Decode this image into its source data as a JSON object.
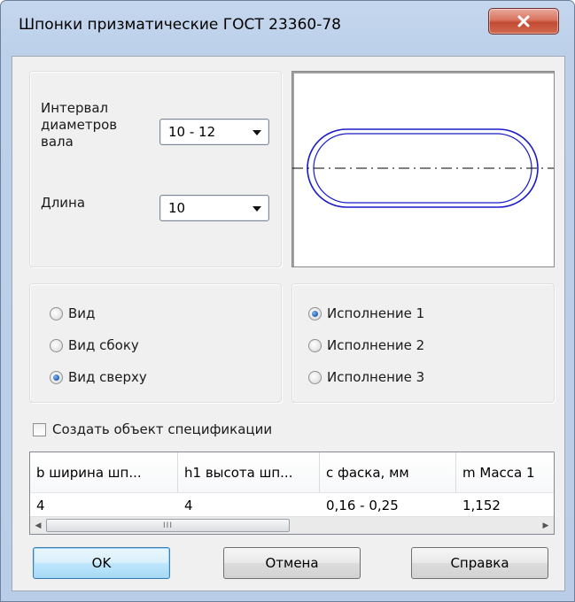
{
  "window": {
    "title": "Шпонки призматические  ГОСТ 23360-78",
    "close_icon": "close-icon",
    "close_color": "#c9503a"
  },
  "params": {
    "interval_label": "Интервал\nдиаметров\nвала",
    "interval_value": "10 - 12",
    "length_label": "Длина",
    "length_value": "10"
  },
  "view_options": [
    {
      "label": "Вид",
      "selected": false
    },
    {
      "label": "Вид сбоку",
      "selected": false
    },
    {
      "label": "Вид сверху",
      "selected": true
    }
  ],
  "execution_options": [
    {
      "label": "Исполнение 1",
      "selected": true
    },
    {
      "label": "Исполнение 2",
      "selected": false
    },
    {
      "label": "Исполнение 3",
      "selected": false
    }
  ],
  "spec_checkbox": {
    "label": "Создать объект спецификации",
    "checked": false
  },
  "table": {
    "columns": [
      "b ширина шп...",
      "h1 высота шп...",
      "с фаска, мм",
      "m Масса 1"
    ],
    "row": [
      "4",
      "4",
      "0,16 - 0,25",
      "1,152"
    ],
    "scroll_thumb_glyph": "III"
  },
  "buttons": {
    "ok": "OK",
    "cancel": "Отмена",
    "help": "Справка"
  },
  "colors": {
    "drawing_stroke": "#1a1ac8",
    "radio_selected": "#1f5fb0",
    "default_button_border": "#3c7fb1"
  }
}
